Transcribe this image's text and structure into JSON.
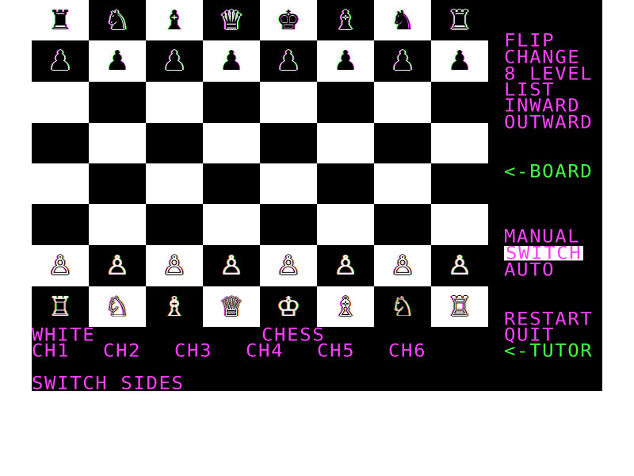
{
  "menu": {
    "flip": "FLIP",
    "change": "CHANGE",
    "level": "8 LEVEL",
    "list": "LIST",
    "inward": "INWARD",
    "outward": "OUTWARD",
    "board": "<-BOARD",
    "manual": "MANUAL",
    "switch": "SWITCH",
    "auto": "AUTO",
    "restart": "RESTART",
    "quit": "QUIT",
    "tutor": "<-TUTOR"
  },
  "status": {
    "side": "WHITE",
    "game": "CHESS",
    "message": "SWITCH SIDES"
  },
  "channels": [
    "CH1",
    "CH2",
    "CH3",
    "CH4",
    "CH5",
    "CH6"
  ],
  "board": [
    [
      "♜",
      "♞",
      "♝",
      "♛",
      "♚",
      "♝",
      "♞",
      "♜"
    ],
    [
      "♟",
      "♟",
      "♟",
      "♟",
      "♟",
      "♟",
      "♟",
      "♟"
    ],
    [
      "",
      "",
      "",
      "",
      "",
      "",
      "",
      ""
    ],
    [
      "",
      "",
      "",
      "",
      "",
      "",
      "",
      ""
    ],
    [
      "",
      "",
      "",
      "",
      "",
      "",
      "",
      ""
    ],
    [
      "",
      "",
      "",
      "",
      "",
      "",
      "",
      ""
    ],
    [
      "♙",
      "♙",
      "♙",
      "♙",
      "♙",
      "♙",
      "♙",
      "♙"
    ],
    [
      "♖",
      "♘",
      "♗",
      "♕",
      "♔",
      "♗",
      "♘",
      "♖"
    ]
  ],
  "colors": {
    "menu_text": "#ff40ff",
    "channel_text": "#ff40ff",
    "highlight": "#ffffff",
    "accent_green": "#40ff40"
  }
}
